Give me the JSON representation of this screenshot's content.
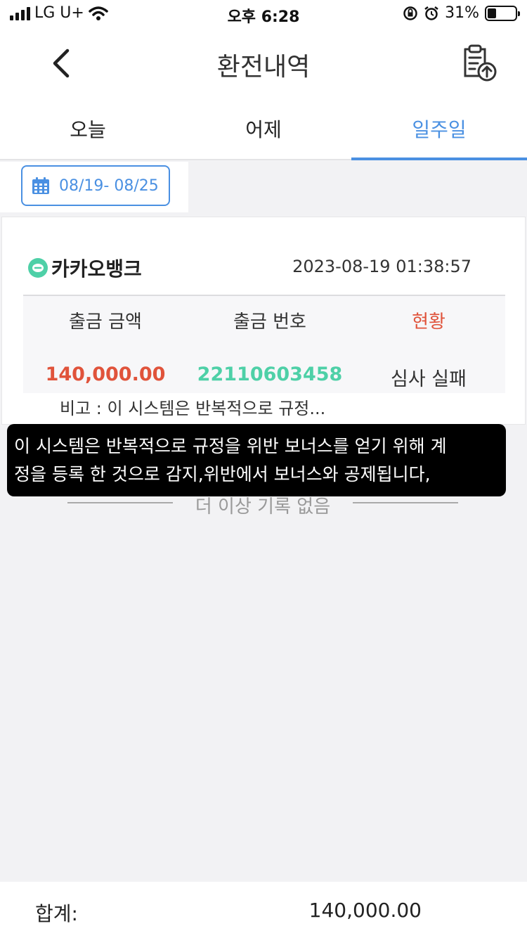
{
  "status_bar": {
    "carrier": "LG U+",
    "time": "오후 6:28",
    "battery": "31%",
    "battery_level": 0.31
  },
  "nav": {
    "title": "환전내역",
    "back_icon": "chevron-left-icon",
    "upload_icon": "clipboard-upload-icon"
  },
  "tabs": [
    {
      "label": "오늘",
      "active": false
    },
    {
      "label": "어제",
      "active": false
    },
    {
      "label": "일주일",
      "active": true
    }
  ],
  "date_filter": {
    "icon": "calendar-icon",
    "range": "08/19- 08/25"
  },
  "record": {
    "bank_icon": "kakaobank-icon",
    "bank": "카카오뱅크",
    "datetime": "2023-08-19 01:38:57",
    "headers": {
      "amount": "출금 금액",
      "number": "출금 번호",
      "status": "현황"
    },
    "amount": "140,000.00",
    "number": "22110603458",
    "status": "심사 실패",
    "remark": "비고 : 이 시스템은 반복적으로 규정..."
  },
  "end_of_list": "더 이상 기록 없음",
  "tooltip": {
    "line1": "이 시스템은 반복적으로 규정을 위반 보너스를 얻기 위해 계",
    "line2": "정을 등록 한 것으로 감지,위반에서 보너스와 공제됩니다,"
  },
  "summary": {
    "label": "합계:",
    "total": "140,000.00"
  },
  "colors": {
    "accent": "#4a90e2",
    "amount": "#e0533b",
    "number": "#4ed0a7",
    "tooltip_bg": "#000000"
  }
}
